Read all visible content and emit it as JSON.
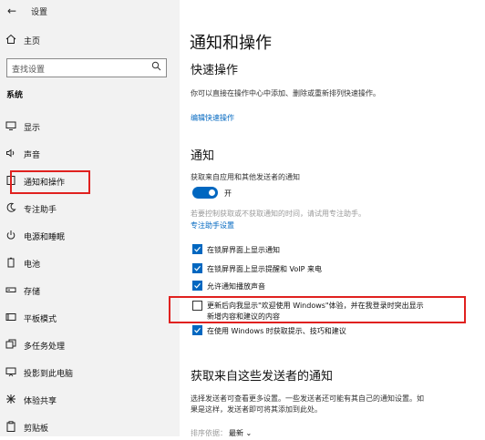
{
  "window": {
    "title": "设置",
    "back_icon": "back-arrow-icon"
  },
  "sidebar": {
    "home_label": "主页",
    "search_placeholder": "查找设置",
    "section_label": "系统",
    "items": [
      {
        "label": "显示",
        "icon": "display-icon"
      },
      {
        "label": "声音",
        "icon": "sound-icon"
      },
      {
        "label": "通知和操作",
        "icon": "notification-icon",
        "highlighted": true
      },
      {
        "label": "专注助手",
        "icon": "moon-icon"
      },
      {
        "label": "电源和睡眠",
        "icon": "power-icon"
      },
      {
        "label": "电池",
        "icon": "battery-icon"
      },
      {
        "label": "存储",
        "icon": "storage-icon"
      },
      {
        "label": "平板模式",
        "icon": "tablet-icon"
      },
      {
        "label": "多任务处理",
        "icon": "multitask-icon"
      },
      {
        "label": "投影到此电脑",
        "icon": "project-icon"
      },
      {
        "label": "体验共享",
        "icon": "share-icon"
      },
      {
        "label": "剪贴板",
        "icon": "clipboard-icon"
      }
    ]
  },
  "main": {
    "title": "通知和操作",
    "quick_actions": {
      "heading": "快速操作",
      "desc": "你可以直接在操作中心中添加、删除或重新排列快速操作。",
      "edit_link": "编辑快速操作"
    },
    "notifications": {
      "heading": "通知",
      "get_from_apps_label": "获取来自应用和其他发送者的通知",
      "toggle_state": "开",
      "toggle_on": true,
      "focus_desc": "若要控制获取或不获取通知的时间，请试用专注助手。",
      "focus_link": "专注助手设置",
      "checkboxes": [
        {
          "label": "在锁屏界面上显示通知",
          "checked": true
        },
        {
          "label": "在锁屏界面上显示提醒和 VoIP 来电",
          "checked": true
        },
        {
          "label": "允许通知播放声音",
          "checked": true
        },
        {
          "label": "更新后向我显示\"欢迎使用 Windows\"体验，并在我登录时突出显示",
          "label2": "新增内容和建议的内容",
          "checked": false
        },
        {
          "label": "在使用 Windows 时获取提示、技巧和建议",
          "checked": true
        }
      ]
    },
    "senders": {
      "heading": "获取来自这些发送者的通知",
      "desc1": "选择发送者可查看更多设置。一些发送者还可能有其自己的通知设置。如",
      "desc2": "果是这样，发送者即可将其添加到此处。",
      "sort_label": "排序依据：",
      "sort_value": "最新"
    }
  },
  "colors": {
    "accent": "#0067c0",
    "highlight": "#e0211f",
    "sidebar_bg": "#f2f2f2"
  }
}
